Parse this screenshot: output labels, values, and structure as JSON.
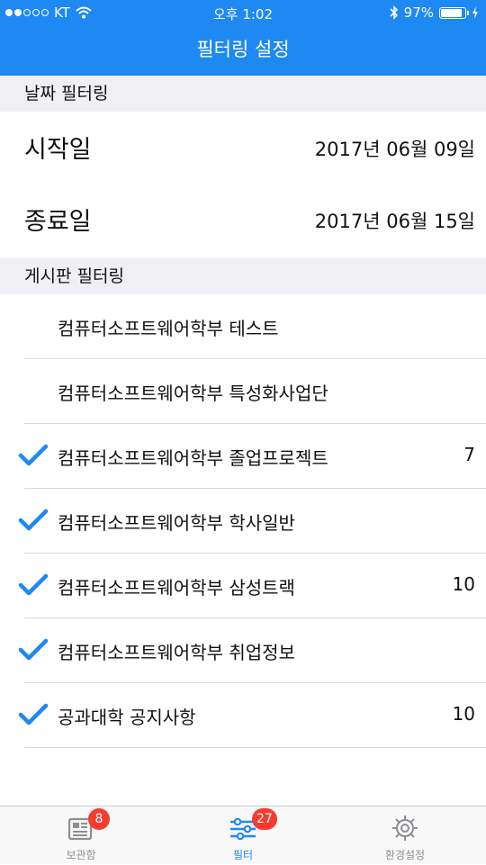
{
  "status_bar": {
    "carrier": "KT",
    "time": "오후 1:02",
    "battery_percent": "97%",
    "battery_level": 0.97
  },
  "header": {
    "title": "필터링 설정"
  },
  "date_filter": {
    "section_title": "날짜 필터링",
    "start": {
      "label": "시작일",
      "value": "2017년 06월 09일"
    },
    "end": {
      "label": "종료일",
      "value": "2017년 06월 15일"
    }
  },
  "board_filter": {
    "section_title": "게시판 필터링",
    "items": [
      {
        "name": "컴퓨터소프트웨어학부 테스트",
        "checked": false,
        "count": ""
      },
      {
        "name": "컴퓨터소프트웨어학부 특성화사업단",
        "checked": false,
        "count": ""
      },
      {
        "name": "컴퓨터소프트웨어학부 졸업프로젝트",
        "checked": true,
        "count": "7"
      },
      {
        "name": "컴퓨터소프트웨어학부 학사일반",
        "checked": true,
        "count": ""
      },
      {
        "name": "컴퓨터소프트웨어학부 삼성트랙",
        "checked": true,
        "count": "10"
      },
      {
        "name": "컴퓨터소프트웨어학부 취업정보",
        "checked": true,
        "count": ""
      },
      {
        "name": "공과대학 공지사항",
        "checked": true,
        "count": "10"
      }
    ]
  },
  "tab_bar": {
    "tabs": [
      {
        "label": "보관함",
        "icon": "newspaper-icon",
        "badge": "8"
      },
      {
        "label": "필터",
        "icon": "sliders-icon",
        "badge": "27",
        "active": true
      },
      {
        "label": "환경설정",
        "icon": "gear-icon",
        "badge": ""
      }
    ]
  },
  "colors": {
    "accent": "#1E88F3",
    "badge": "#F53B30",
    "section_bg": "#EFEFF4"
  }
}
